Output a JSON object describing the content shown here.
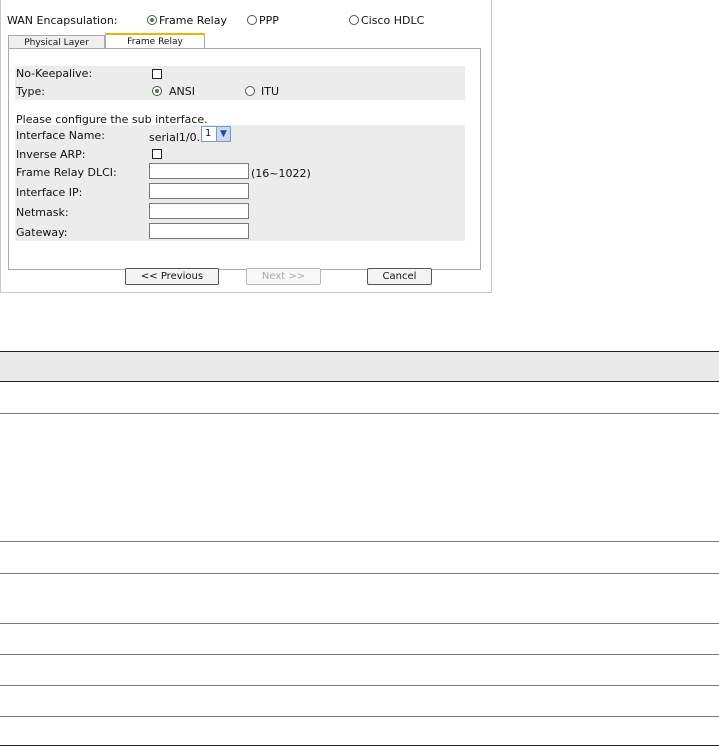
{
  "wan": {
    "label": "WAN Encapsulation:",
    "options": [
      {
        "label": "Frame Relay",
        "selected": true
      },
      {
        "label": "PPP",
        "selected": false
      },
      {
        "label": "Cisco HDLC",
        "selected": false
      }
    ]
  },
  "tabs": [
    {
      "label": "Physical Layer",
      "active": false
    },
    {
      "label": "Frame Relay",
      "active": true
    }
  ],
  "frame_relay": {
    "no_keepalive_label": "No-Keepalive:",
    "no_keepalive_checked": false,
    "type_label": "Type:",
    "type_options": [
      {
        "label": "ANSI",
        "selected": true
      },
      {
        "label": "ITU",
        "selected": false
      }
    ],
    "sub_interface_heading": "Please configure the sub interface.",
    "interface_name_label": "Interface Name:",
    "interface_prefix": "serial1/0.",
    "interface_select_value": "1",
    "inverse_arp_label": "Inverse ARP:",
    "inverse_arp_checked": false,
    "dlci_label": "Frame Relay DLCI:",
    "dlci_value": "",
    "dlci_range": "(16~1022)",
    "interface_ip_label": "Interface IP:",
    "interface_ip_value": "",
    "netmask_label": "Netmask:",
    "netmask_value": "",
    "gateway_label": "Gateway:",
    "gateway_value": ""
  },
  "buttons": {
    "previous": "<< Previous",
    "next": "Next >>",
    "cancel": "Cancel"
  },
  "colors": {
    "radio_selected": "#2f8a2f",
    "active_tab_accent": "#e6b800",
    "panel_gray": "#ececec"
  }
}
